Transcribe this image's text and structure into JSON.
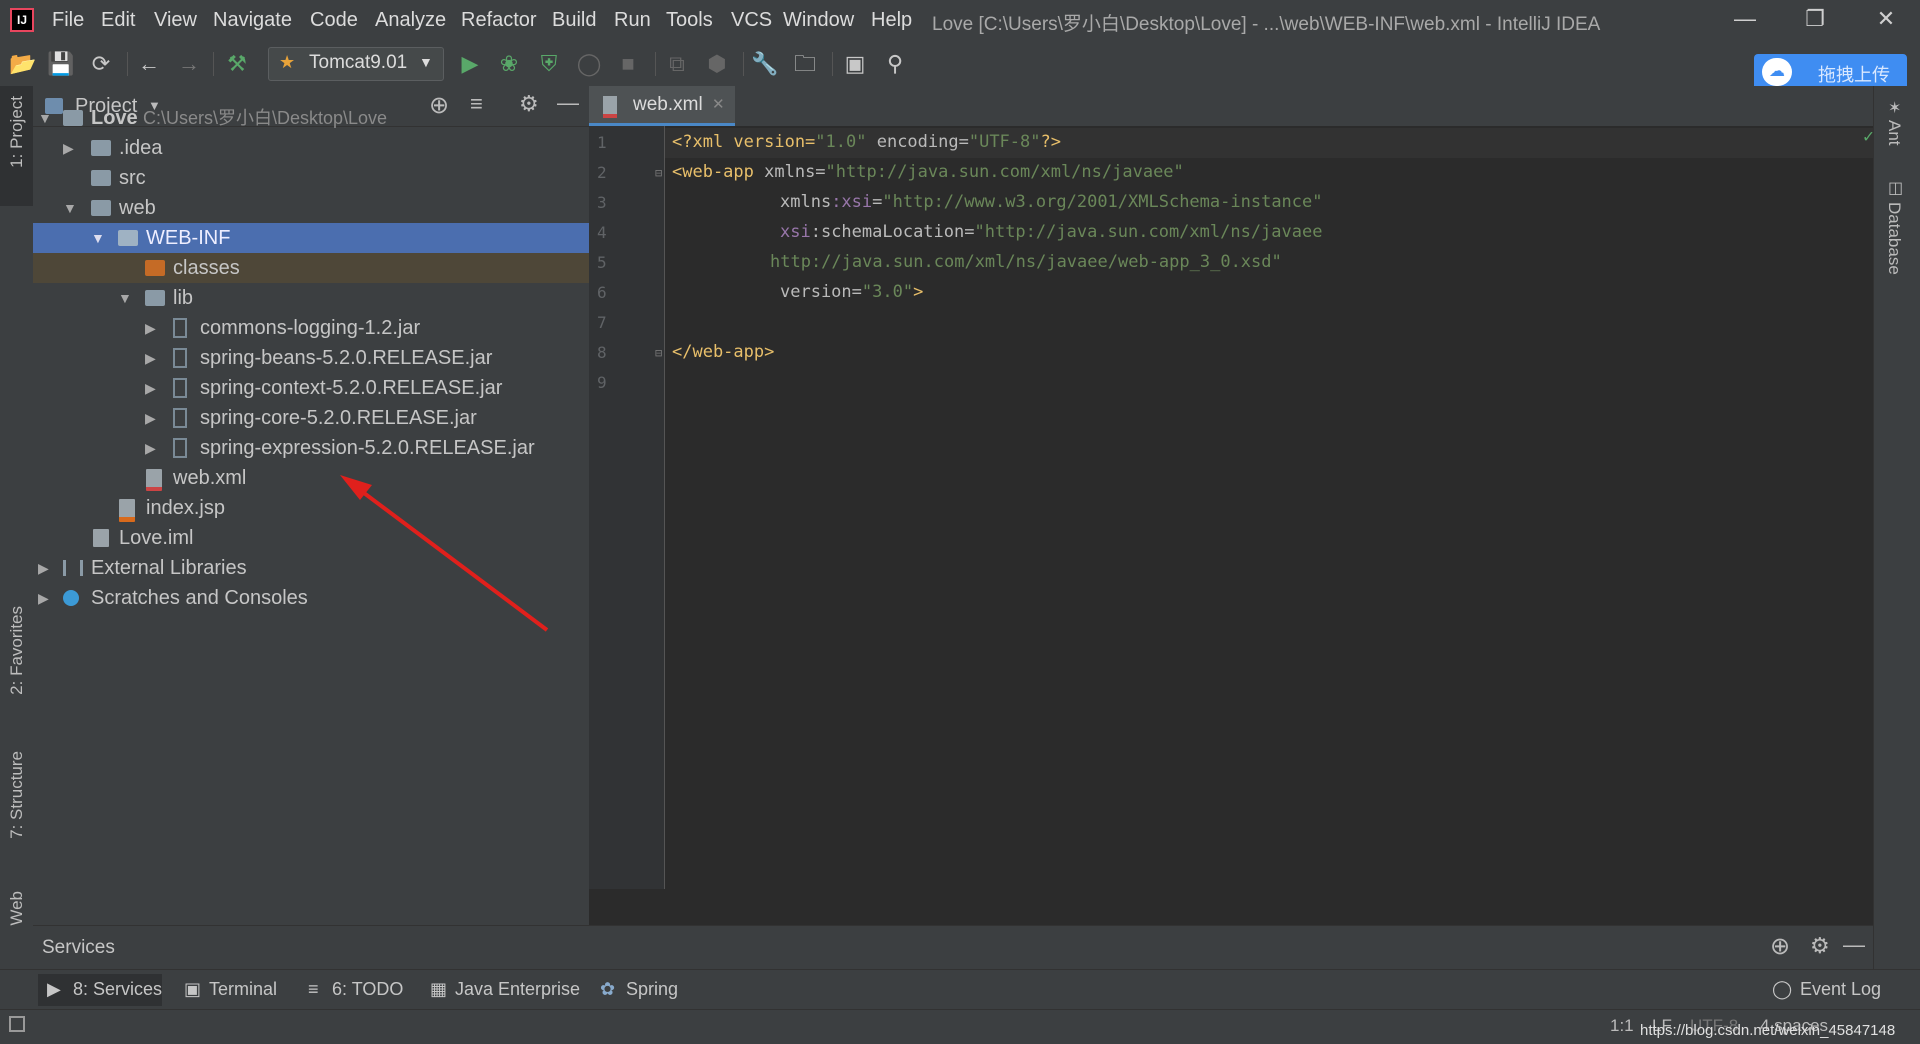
{
  "menubar": {
    "items": [
      "File",
      "Edit",
      "View",
      "Navigate",
      "Code",
      "Analyze",
      "Refactor",
      "Build",
      "Run",
      "Tools",
      "VCS",
      "Window",
      "Help"
    ],
    "title": "Love [C:\\Users\\罗小白\\Desktop\\Love] - ...\\web\\WEB-INF\\web.xml - IntelliJ IDEA"
  },
  "toolbar": {
    "run_config": "Tomcat9.01",
    "upload_label": "拖拽上传"
  },
  "project_panel": {
    "title": "Project",
    "tree": [
      {
        "label": "Love",
        "path": "C:\\Users\\罗小白\\Desktop\\Love"
      },
      {
        "label": ".idea"
      },
      {
        "label": "src"
      },
      {
        "label": "web"
      },
      {
        "label": "WEB-INF"
      },
      {
        "label": "classes"
      },
      {
        "label": "lib"
      },
      {
        "label": "commons-logging-1.2.jar"
      },
      {
        "label": "spring-beans-5.2.0.RELEASE.jar"
      },
      {
        "label": "spring-context-5.2.0.RELEASE.jar"
      },
      {
        "label": "spring-core-5.2.0.RELEASE.jar"
      },
      {
        "label": "spring-expression-5.2.0.RELEASE.jar"
      },
      {
        "label": "web.xml"
      },
      {
        "label": "index.jsp"
      },
      {
        "label": "Love.iml"
      },
      {
        "label": "External Libraries"
      },
      {
        "label": "Scratches and Consoles"
      }
    ]
  },
  "left_stripe": {
    "project": "1: Project",
    "favorites": "2: Favorites",
    "structure": "7: Structure",
    "web": "Web"
  },
  "right_stripe": {
    "ant": "Ant",
    "database": "Database"
  },
  "editor": {
    "tab": "web.xml",
    "line_numbers": [
      "1",
      "2",
      "3",
      "4",
      "5",
      "6",
      "7",
      "8",
      "9"
    ],
    "lines": {
      "l1_a": "<?xml version=",
      "l1_b": "\"1.0\"",
      "l1_c": " encoding=",
      "l1_d": "\"UTF-8\"",
      "l1_e": "?>",
      "l2_a": "<web-app",
      "l2_b": " xmlns=",
      "l2_c": "\"http://java.sun.com/xml/ns/javaee\"",
      "l3_a": "xmlns",
      "l3_b": ":xsi",
      "l3_c": "=",
      "l3_d": "\"http://www.w3.org/2001/XMLSchema-instance\"",
      "l4_a": "xsi",
      "l4_b": ":schemaLocation=",
      "l4_c": "\"http://java.sun.com/xml/ns/javaee",
      "l5": "http://java.sun.com/xml/ns/javaee/web-app_3_0.xsd\"",
      "l6_a": "version=",
      "l6_b": "\"3.0\"",
      "l6_c": ">",
      "l8": "</web-app>"
    }
  },
  "services": {
    "title": "Services"
  },
  "bottom_tabs": [
    "8: Services",
    "Terminal",
    "6: TODO",
    "Java Enterprise",
    "Spring",
    "Event Log"
  ],
  "statusbar": {
    "position": "1:1",
    "line_sep": "LF",
    "encoding": "UTF-8",
    "indent": "4 spaces",
    "watermark": "https://blog.csdn.net/weixin_45847148"
  },
  "colors": {
    "selection": "#4b6eaf",
    "accent_blue": "#3f8df2",
    "folder_orange": "#c56b26"
  }
}
